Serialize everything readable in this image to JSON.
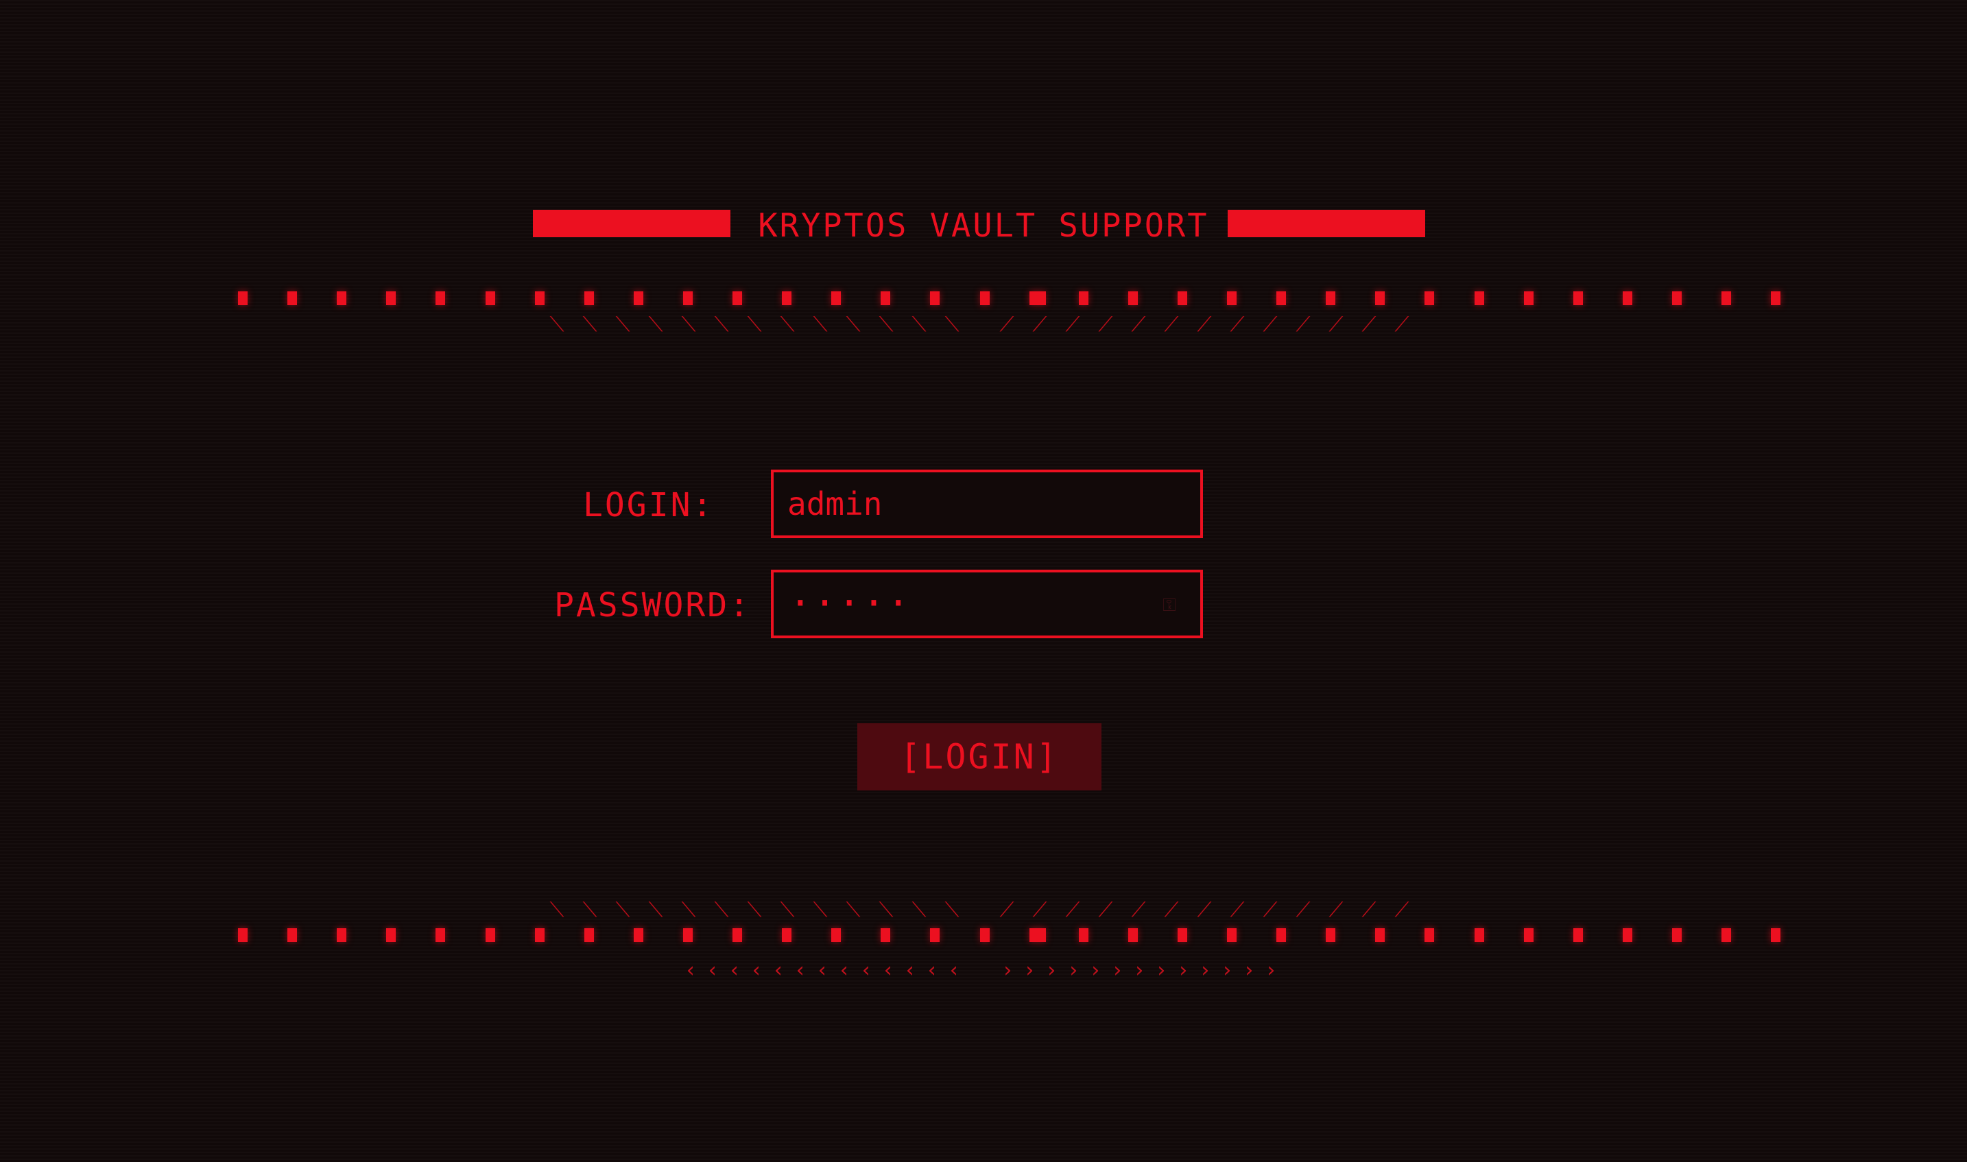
{
  "header": {
    "title": "KRYPTOS VAULT SUPPORT"
  },
  "form": {
    "login_label": "LOGIN:",
    "login_value": "admin",
    "password_label": "PASSWORD:",
    "password_masked": "·····",
    "password_toggle_icon": "show-password-icon",
    "submit_label": "[LOGIN]"
  },
  "decor": {
    "slash_left": "⟍",
    "slash_right": "⟋",
    "chevron_left": "‹",
    "chevron_right": "›"
  },
  "colors": {
    "accent": "#ec1020",
    "background": "#110909",
    "button_bg": "#4e0a10"
  }
}
